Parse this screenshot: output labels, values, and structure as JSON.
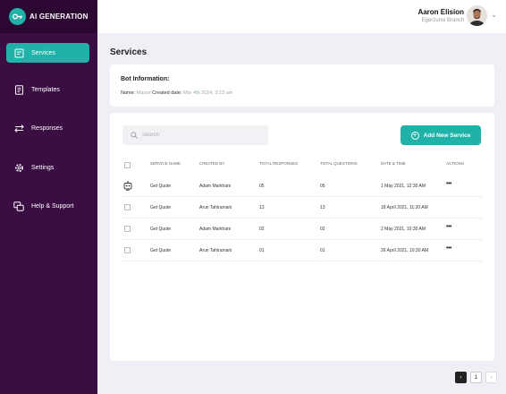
{
  "brand": {
    "name": "AI GENERATION"
  },
  "sidebar": {
    "items": [
      {
        "label": "Services",
        "icon": "services-icon",
        "active": true
      },
      {
        "label": "Templates",
        "icon": "templates-icon"
      },
      {
        "label": "Responses",
        "icon": "responses-icon"
      },
      {
        "label": "Settings",
        "icon": "gear-icon"
      },
      {
        "label": "Help & Support",
        "icon": "help-support-icon"
      }
    ]
  },
  "user": {
    "name": "Aaron Elision",
    "subtitle": "Egerzunsi Branch"
  },
  "page": {
    "title": "Services"
  },
  "bot_info": {
    "title": "Bot Information:",
    "name_label": "Name:",
    "name_value": "Maxxx",
    "created_label": "Created date:",
    "created_value": "Mar 4th 2024, 3:13 am"
  },
  "search": {
    "placeholder": "Search",
    "value": ""
  },
  "add_button": {
    "label": "Add New Service"
  },
  "table": {
    "headers": [
      "SERVICE NAME",
      "CREATED BY",
      "TOTAL RESPONSES",
      "TOTAL QUESTIONS",
      "DATE & TIME",
      "ACTIONS"
    ],
    "rows": [
      {
        "service": "Get Quote",
        "created_by": "Adam Markham",
        "responses": "05",
        "questions": "05",
        "datetime": "1 May 2021, 12:30 AM",
        "actions": "•••",
        "bot_icon": true
      },
      {
        "service": "Get Quote",
        "created_by": "Arun Tahiramani",
        "responses": "13",
        "questions": "13",
        "datetime": "18 April 2021, 11:30 AM",
        "actions": ""
      },
      {
        "service": "Get Quote",
        "created_by": "Adam Markham",
        "responses": "02",
        "questions": "02",
        "datetime": "2 May 2021, 10:30 AM",
        "actions": "•••"
      },
      {
        "service": "Get Quote",
        "created_by": "Arun Tahiramani",
        "responses": "01",
        "questions": "01",
        "datetime": "26 April 2021, 10:30 AM",
        "actions": "•••"
      }
    ]
  },
  "pagination": {
    "prev": "‹",
    "current": "1",
    "next": "›"
  },
  "colors": {
    "sidebar": "#3a0d43",
    "accent": "#20b2a8",
    "background": "#eef0f5"
  }
}
